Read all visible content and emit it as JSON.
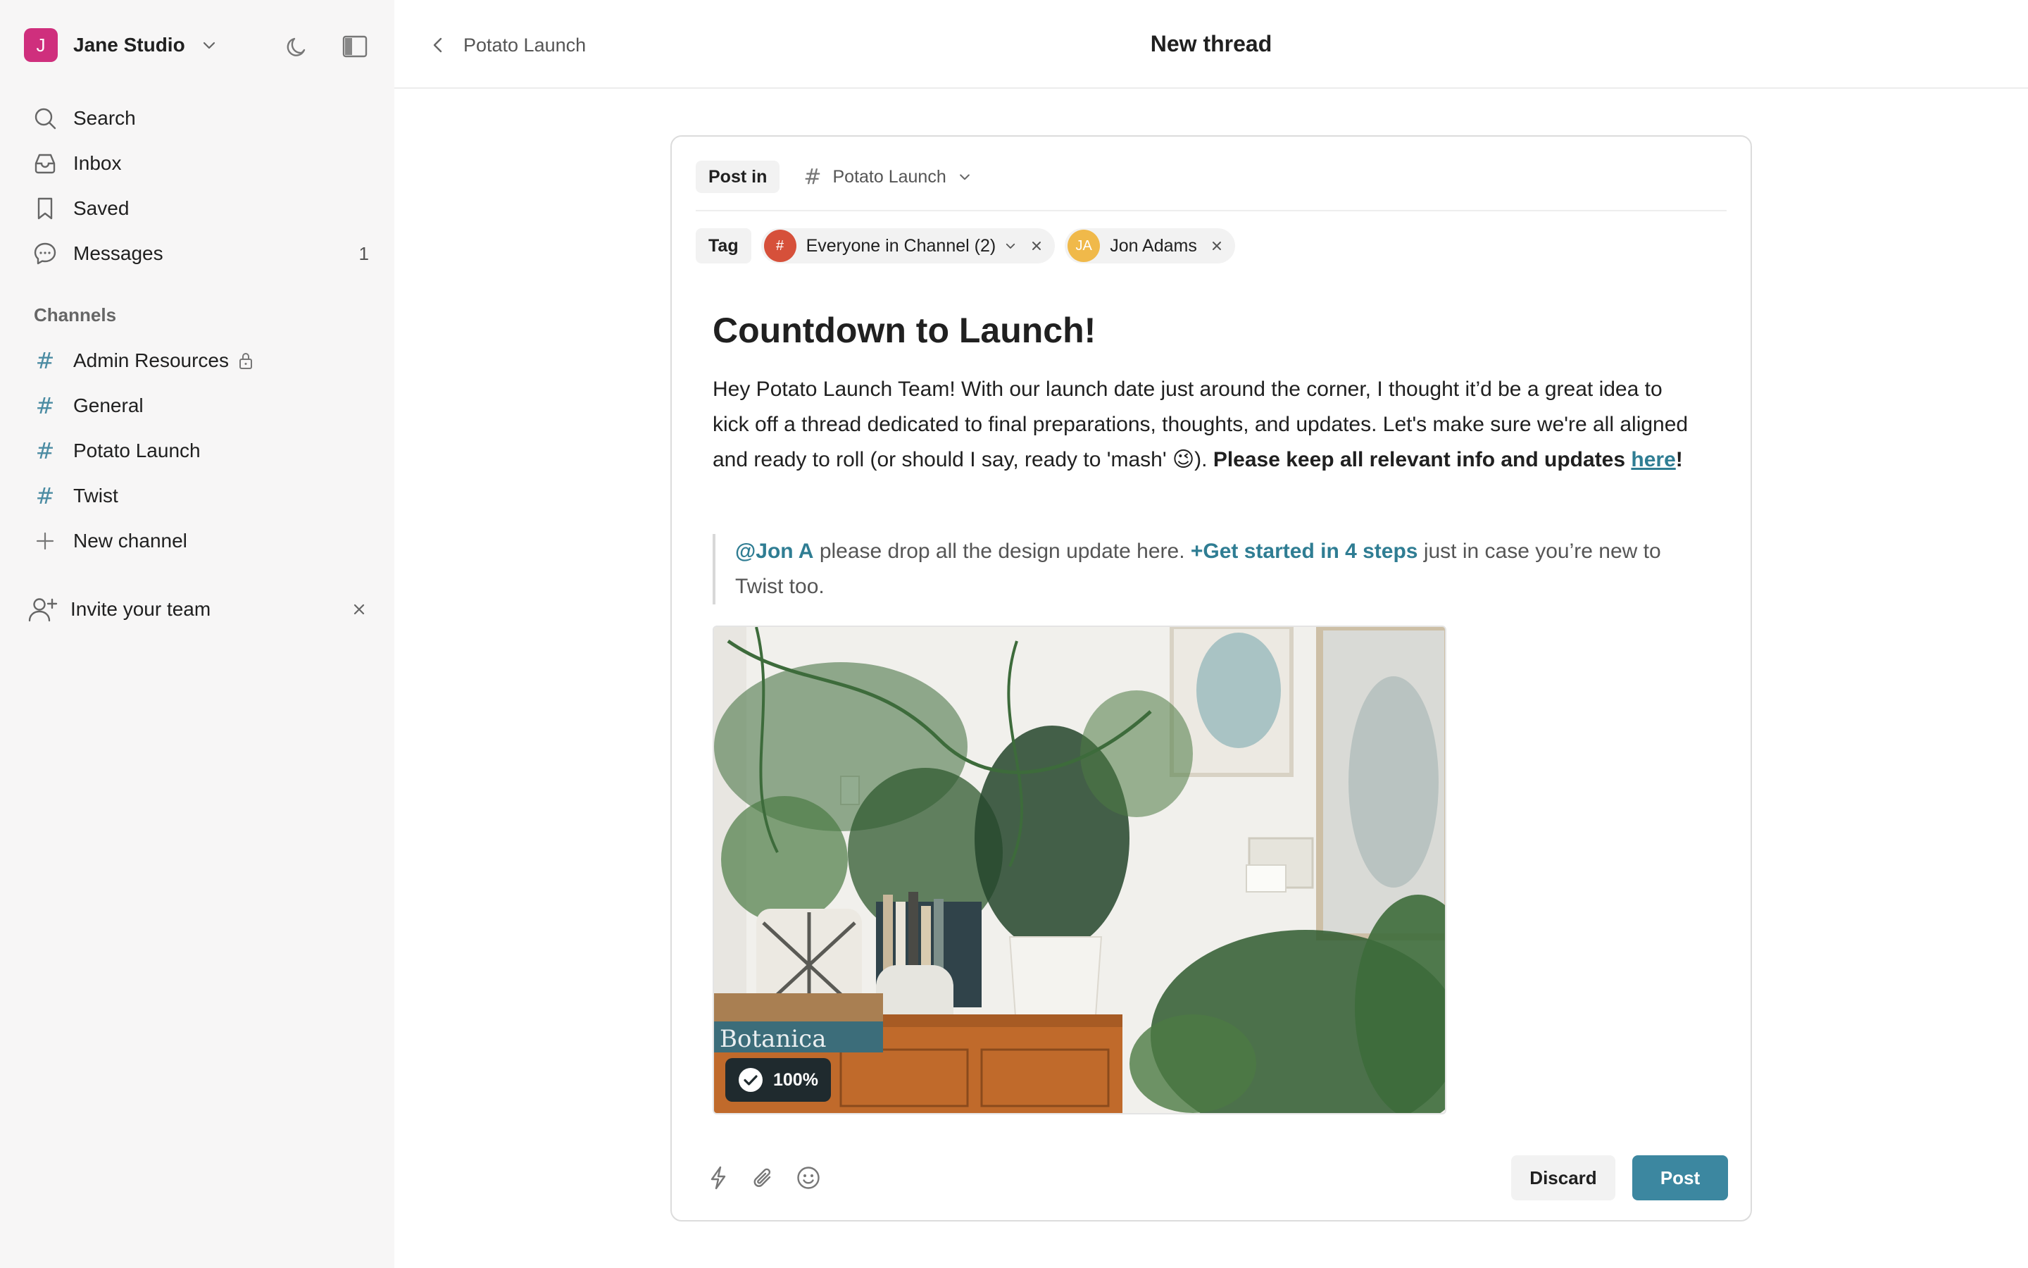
{
  "workspace": {
    "initial": "J",
    "name": "Jane Studio",
    "avatar_color": "#cf2f7d"
  },
  "nav": [
    {
      "label": "Search",
      "icon": "search-icon"
    },
    {
      "label": "Inbox",
      "icon": "inbox-icon"
    },
    {
      "label": "Saved",
      "icon": "bookmark-icon"
    },
    {
      "label": "Messages",
      "icon": "chat-bubble-icon",
      "count": "1"
    }
  ],
  "channels": {
    "title": "Channels",
    "items": [
      {
        "label": "Admin Resources",
        "icon": "hash-icon",
        "locked": true
      },
      {
        "label": "General",
        "icon": "hash-icon"
      },
      {
        "label": "Potato Launch",
        "icon": "hash-icon"
      },
      {
        "label": "Twist",
        "icon": "hash-icon"
      }
    ],
    "new_label": "New channel"
  },
  "invite": {
    "label": "Invite your team"
  },
  "topbar": {
    "back_label": "Potato Launch",
    "title": "New thread"
  },
  "composer": {
    "post_in_label": "Post in",
    "channel_name": "Potato Launch",
    "tag_label": "Tag",
    "tags": [
      {
        "label": "Everyone in Channel (2)",
        "avatar": "#",
        "color": "#d6503a",
        "has_dropdown": true
      },
      {
        "label": "Jon Adams",
        "avatar": "JA",
        "color": "#f0b94a",
        "has_dropdown": false
      }
    ],
    "headline": "Countdown to Launch!",
    "body": {
      "text": "Hey Potato Launch Team! With our launch date just around the corner, I thought it’d be a great idea to kick off a thread dedicated to final preparations, thoughts, and updates. Let's make sure we're all aligned and ready to roll (or should I say, ready to 'mash' 😉). ",
      "bold": "Please keep all relevant info and updates ",
      "link": "here",
      "bold_end": "!"
    },
    "quote": {
      "mention": "@Jon A",
      "text1": " please drop all the design update here. ",
      "link": "+Get started in 4 steps",
      "text2": " just in case you’re new to Twist too."
    },
    "image_badge": "100%",
    "image_text": "Botanica",
    "discard_label": "Discard",
    "post_label": "Post"
  },
  "colors": {
    "accent": "#3c87a0",
    "link": "#2f7d93",
    "hash": "#4c8ca3"
  }
}
